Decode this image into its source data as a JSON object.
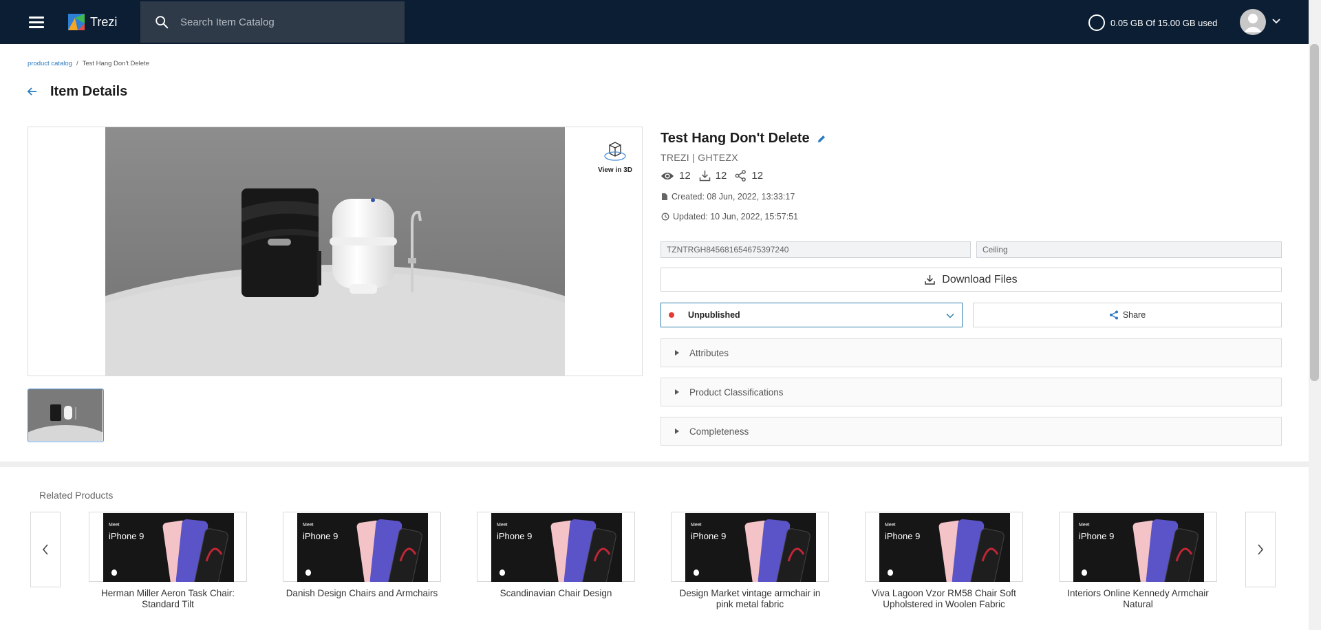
{
  "header": {
    "app_name": "Trezi",
    "search_placeholder": "Search Item Catalog",
    "storage_text": "0.05 GB Of 15.00 GB used"
  },
  "breadcrumb": {
    "parent": "product catalog",
    "separator": "/",
    "current": "Test Hang Don't Delete"
  },
  "page": {
    "title": "Item Details"
  },
  "viewer": {
    "view3d_label": "View in 3D"
  },
  "item": {
    "name": "Test Hang Don't Delete",
    "vendor": "TREZI | GHTEZX",
    "views": "12",
    "downloads": "12",
    "shares": "12",
    "created": "Created: 08 Jun, 2022, 13:33:17",
    "updated": "Updated: 10 Jun, 2022, 15:57:51",
    "code": "TZNTRGH845681654675397240",
    "category": "Ceiling",
    "download_label": "Download Files",
    "status": "Unpublished",
    "status_color": "#e53935",
    "share_label": "Share"
  },
  "sections": [
    "Attributes",
    "Product Classifications",
    "Completeness"
  ],
  "related": {
    "title": "Related Products",
    "card_art_text": {
      "meet": "Meet",
      "brand": "iPhone 9"
    },
    "items": [
      "Herman Miller Aeron Task Chair: Standard Tilt",
      "Danish Design Chairs and Armchairs",
      "Scandinavian Chair Design",
      "Design Market vintage armchair in pink metal fabric",
      "Viva Lagoon Vzor RM58 Chair Soft Upholstered in Woolen Fabric",
      "Interiors Online Kennedy Armchair Natural"
    ]
  },
  "colors": {
    "topbar": "#0c1e33",
    "accent": "#2a7ac0",
    "phone_purple": "#5b54c9",
    "phone_pink": "#f0b2b8"
  }
}
